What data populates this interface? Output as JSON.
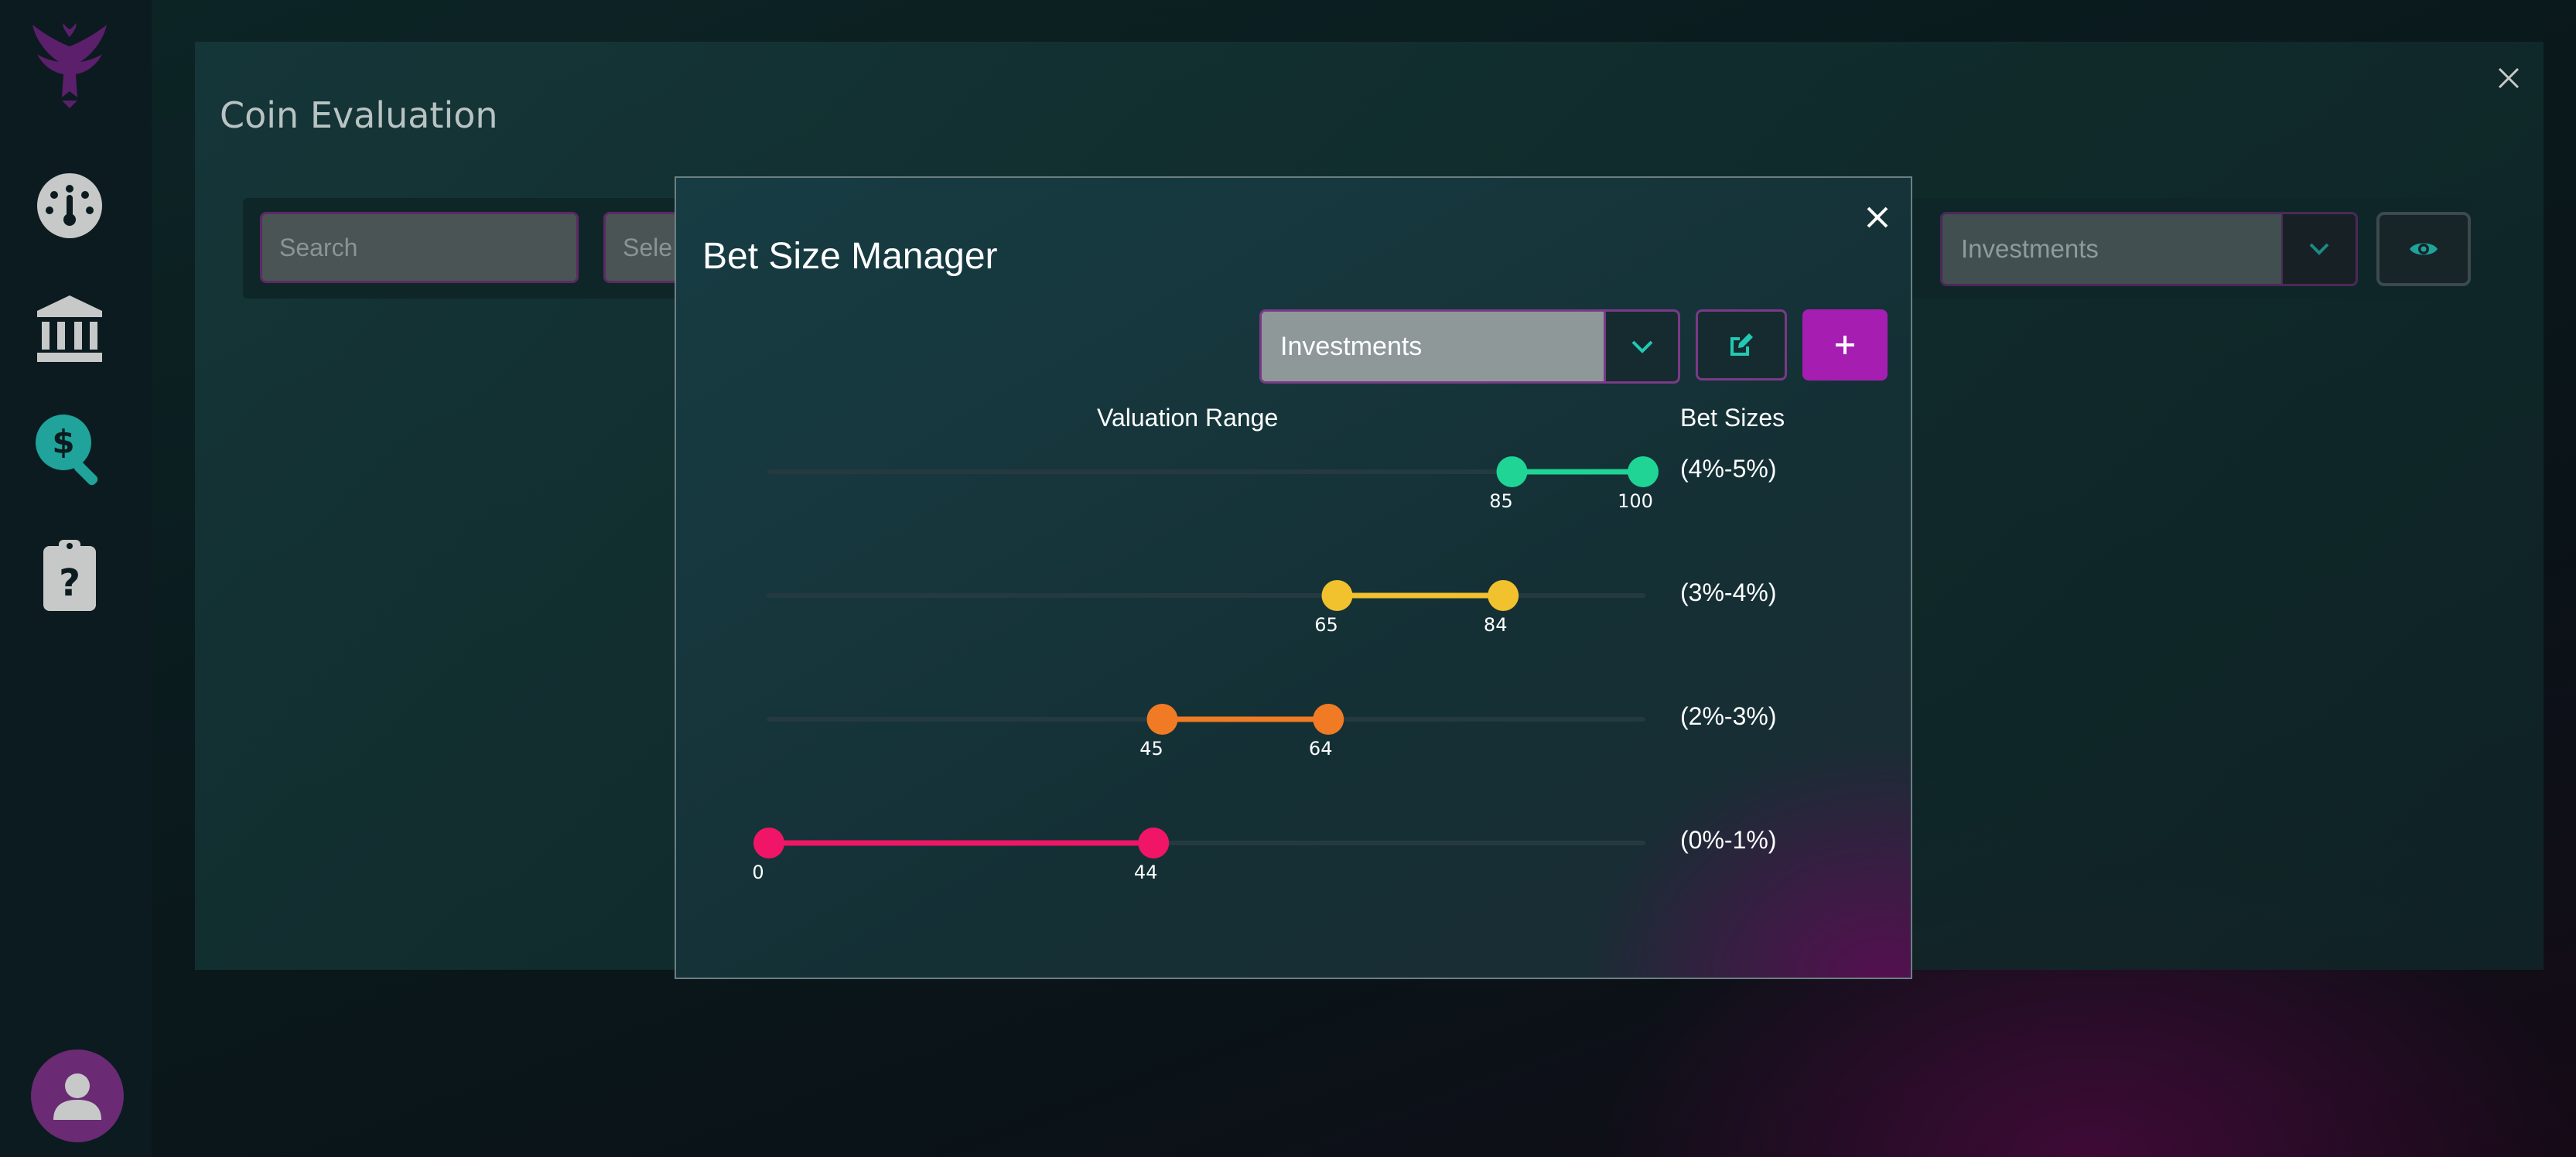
{
  "sidebar": {
    "items": [
      {
        "icon": "phoenix-logo-icon"
      },
      {
        "icon": "dashboard-gauge-icon"
      },
      {
        "icon": "bank-icon"
      },
      {
        "icon": "coin-search-icon",
        "active": true
      },
      {
        "icon": "clipboard-question-icon"
      }
    ],
    "avatar_icon": "user-icon"
  },
  "panel": {
    "title": "Coin Evaluation",
    "search_placeholder": "Search",
    "select_partial": "Sele",
    "portfolio_select": "Investments"
  },
  "modal": {
    "title": "Bet Size Manager",
    "portfolio_select": "Investments",
    "valuation_header": "Valuation Range",
    "bet_header": "Bet Sizes",
    "ranges": [
      {
        "min": 85,
        "max": 100,
        "min_label": "85",
        "max_label": "100",
        "bet": "(4%-5%)",
        "color": "#1fd494"
      },
      {
        "min": 65,
        "max": 84,
        "min_label": "65",
        "max_label": "84",
        "bet": "(3%-4%)",
        "color": "#f2c12e"
      },
      {
        "min": 45,
        "max": 64,
        "min_label": "45",
        "max_label": "64",
        "bet": "(2%-3%)",
        "color": "#f07b24"
      },
      {
        "min": 0,
        "max": 44,
        "min_label": "0",
        "max_label": "44",
        "bet": "(0%-1%)",
        "color": "#f01566"
      }
    ]
  },
  "colors": {
    "accent_purple": "#a61eb1",
    "accent_teal": "#22c9b4",
    "sidebar_bg": "#0b1b1f"
  }
}
